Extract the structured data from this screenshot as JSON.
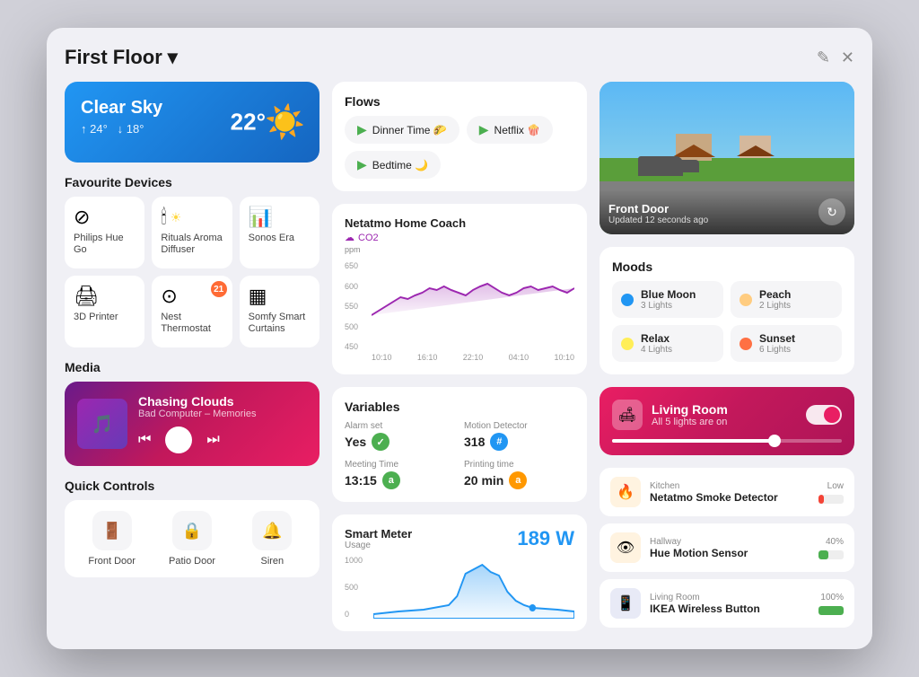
{
  "window": {
    "title": "First Floor",
    "title_suffix": "▾",
    "edit_icon": "✎",
    "close_icon": "✕"
  },
  "weather": {
    "condition": "Clear Sky",
    "temp": "22°",
    "high": "↑ 24°",
    "low": "↓ 18°",
    "icon": "☀️"
  },
  "sections": {
    "favourite_devices": "Favourite Devices",
    "media": "Media",
    "quick_controls": "Quick Controls",
    "flows": "Flows",
    "moods": "Moods",
    "variables": "Variables"
  },
  "devices": [
    {
      "name": "Philips Hue Go",
      "icon": "⊘"
    },
    {
      "name": "Rituals Aroma Diffuser",
      "icon": "🕯",
      "extra_icon": "🔆"
    },
    {
      "name": "Sonos Era",
      "icon": "📊"
    },
    {
      "name": "3D Printer",
      "icon": "🖨"
    },
    {
      "name": "Nest Thermostat",
      "icon": "⊙",
      "badge": "21"
    },
    {
      "name": "Somfy Smart Curtains",
      "icon": "▦"
    }
  ],
  "media": {
    "title": "Chasing Clouds",
    "artist": "Bad Computer – Memories",
    "prev": "⏮",
    "pause": "⏸",
    "next": "⏭"
  },
  "quick_controls": [
    {
      "label": "Front Door",
      "icon": "🚪"
    },
    {
      "label": "Patio Door",
      "icon": "🔒"
    },
    {
      "label": "Siren",
      "icon": "🔔"
    }
  ],
  "flows": [
    {
      "label": "Dinner Time 🌮",
      "play": "▶"
    },
    {
      "label": "Netflix 🍿",
      "play": "▶"
    },
    {
      "label": "Bedtime 🌙",
      "play": "▶"
    }
  ],
  "netatmo": {
    "title": "Netatmo Home Coach",
    "subtitle": "CO2",
    "y_labels": [
      "650",
      "600",
      "550",
      "500",
      "450"
    ],
    "x_labels": [
      "10:10",
      "16:10",
      "22:10",
      "04:10",
      "10:10"
    ]
  },
  "variables": [
    {
      "label": "Alarm set",
      "value": "Yes",
      "badge": "✓",
      "badge_class": "badge-green"
    },
    {
      "label": "Motion Detector",
      "value": "318",
      "badge": "#",
      "badge_class": "badge-blue"
    },
    {
      "label": "Meeting Time",
      "value": "13:15",
      "badge": "a",
      "badge_class": "badge-green"
    },
    {
      "label": "Printing time",
      "value": "20 min",
      "badge": "a",
      "badge_class": "badge-orange"
    }
  ],
  "smart_meter": {
    "title": "Smart Meter",
    "subtitle": "Usage",
    "value": "189 W",
    "y_labels": [
      "1000",
      "500",
      "0"
    ]
  },
  "camera": {
    "title": "Front Door",
    "updated": "Updated 12 seconds ago"
  },
  "moods": [
    {
      "name": "Blue Moon",
      "lights": "3 Lights",
      "color": "#2196f3"
    },
    {
      "name": "Peach",
      "lights": "2 Lights",
      "color": "#ffcc80"
    },
    {
      "name": "Relax",
      "lights": "4 Lights",
      "color": "#ffee58"
    },
    {
      "name": "Sunset",
      "lights": "6 Lights",
      "color": "#ff7043"
    }
  ],
  "living_room": {
    "title": "Living Room",
    "subtitle": "All 5 lights are on",
    "icon": "🛋"
  },
  "device_list": [
    {
      "location": "Kitchen",
      "name": "Netatmo Smoke Detector",
      "status": "Low",
      "battery_class": "battery-low",
      "icon": "🔥",
      "icon_bg": "#ff9800"
    },
    {
      "location": "Hallway",
      "name": "Hue Motion Sensor",
      "status": "40%",
      "battery_class": "battery-mid",
      "icon": "👁",
      "icon_bg": "#ff9800"
    },
    {
      "location": "Living Room",
      "name": "IKEA Wireless Button",
      "status": "100%",
      "battery_class": "battery-full",
      "icon": "📱",
      "icon_bg": "#5c6bc0"
    }
  ]
}
